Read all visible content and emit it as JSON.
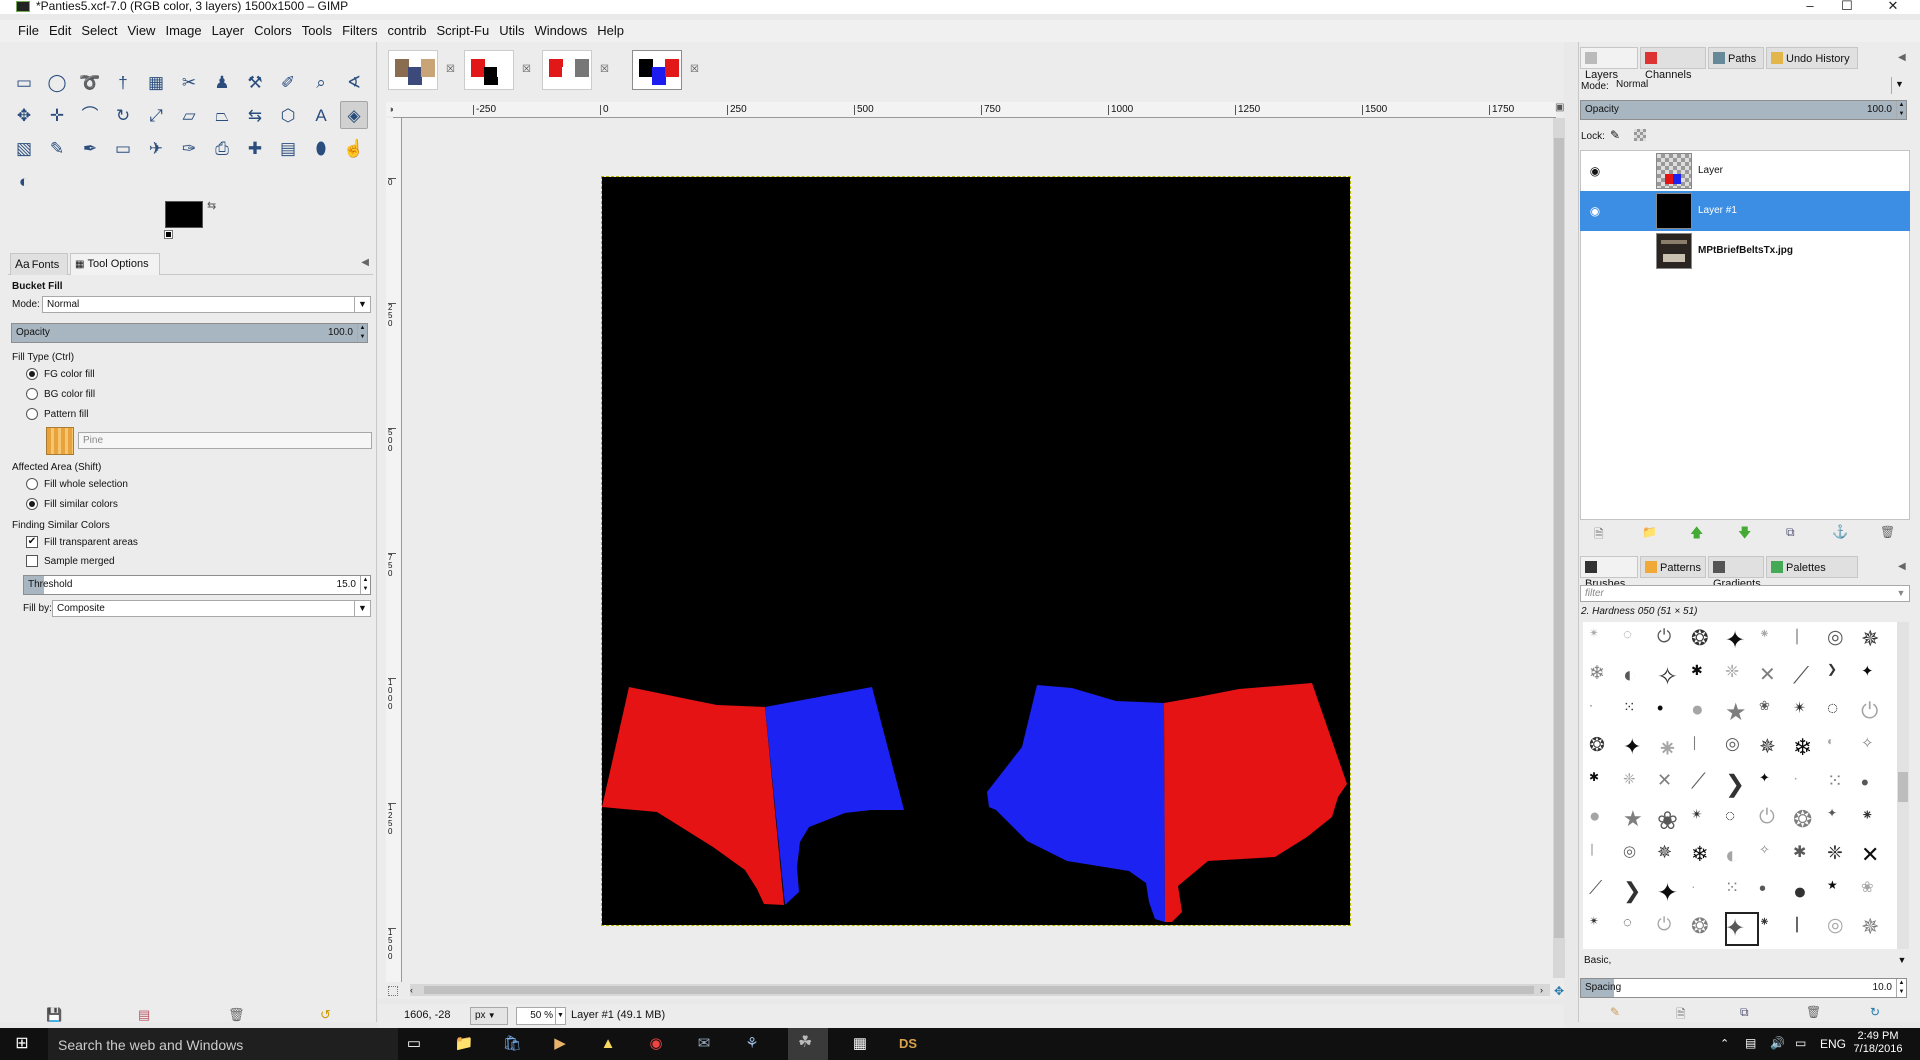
{
  "window": {
    "title": "*Panties5.xcf-7.0 (RGB color, 3 layers) 1500x1500 – GIMP",
    "minimize": "–",
    "maximize": "☐",
    "close": "✕"
  },
  "menu": [
    "File",
    "Edit",
    "Select",
    "View",
    "Image",
    "Layer",
    "Colors",
    "Tools",
    "Filters",
    "contrib",
    "Script-Fu",
    "Utils",
    "Windows",
    "Help"
  ],
  "toolbox": {
    "tools": [
      {
        "name": "rect-select-icon",
        "glyph": "▭"
      },
      {
        "name": "ellipse-select-icon",
        "glyph": "◯"
      },
      {
        "name": "free-select-icon",
        "glyph": "➰"
      },
      {
        "name": "fuzzy-select-icon",
        "glyph": "†"
      },
      {
        "name": "select-by-color-icon",
        "glyph": "▦"
      },
      {
        "name": "scissors-icon",
        "glyph": "✂"
      },
      {
        "name": "foreground-select-icon",
        "glyph": "♟"
      },
      {
        "name": "paths-icon",
        "glyph": "⚒"
      },
      {
        "name": "color-picker-icon",
        "glyph": "✐"
      },
      {
        "name": "zoom-icon",
        "glyph": "⌕"
      },
      {
        "name": "measure-icon",
        "glyph": "∢"
      },
      {
        "name": "move-icon",
        "glyph": "✥"
      },
      {
        "name": "align-icon",
        "glyph": "✛"
      },
      {
        "name": "crop-icon",
        "glyph": "⌒"
      },
      {
        "name": "rotate-icon",
        "glyph": "↻"
      },
      {
        "name": "scale-icon",
        "glyph": "⤢"
      },
      {
        "name": "shear-icon",
        "glyph": "▱"
      },
      {
        "name": "perspective-icon",
        "glyph": "⏢"
      },
      {
        "name": "flip-icon",
        "glyph": "⇆"
      },
      {
        "name": "cage-icon",
        "glyph": "⬡"
      },
      {
        "name": "text-icon",
        "glyph": "A"
      },
      {
        "name": "bucket-fill-icon",
        "glyph": "◈"
      },
      {
        "name": "blend-icon",
        "glyph": "▧"
      },
      {
        "name": "pencil-icon",
        "glyph": "✎"
      },
      {
        "name": "paintbrush-icon",
        "glyph": "✒"
      },
      {
        "name": "eraser-icon",
        "glyph": "▭"
      },
      {
        "name": "airbrush-icon",
        "glyph": "✈"
      },
      {
        "name": "ink-icon",
        "glyph": "✑"
      },
      {
        "name": "clone-icon",
        "glyph": "⎙"
      },
      {
        "name": "heal-icon",
        "glyph": "✚"
      },
      {
        "name": "perspective-clone-icon",
        "glyph": "▤"
      },
      {
        "name": "blur-icon",
        "glyph": "⬮"
      },
      {
        "name": "smudge-icon",
        "glyph": "☝"
      },
      {
        "name": "dodge-burn-icon",
        "glyph": "◐"
      }
    ],
    "fg_color": "#000000",
    "bg_color": "#ffffff"
  },
  "options": {
    "tab_fonts": "Fonts",
    "tab_fonts_icon": "Aa",
    "tab_tool_options": "Tool Options",
    "tool_name": "Bucket Fill",
    "mode_label": "Mode:",
    "mode_value": "Normal",
    "opacity_label": "Opacity",
    "opacity_value": "100.0",
    "opacity_percent": 100,
    "fill_type_label": "Fill Type  (Ctrl)",
    "fill_fg": "FG color fill",
    "fill_bg": "BG color fill",
    "fill_pattern": "Pattern fill",
    "pattern_name": "Pine",
    "affected_label": "Affected Area  (Shift)",
    "affected_whole": "Fill whole selection",
    "affected_similar": "Fill similar colors",
    "finding_label": "Finding Similar Colors",
    "fill_transparent": "Fill transparent areas",
    "fill_transparent_checked": true,
    "sample_merged": "Sample merged",
    "sample_merged_checked": false,
    "threshold_label": "Threshold",
    "threshold_value": "15.0",
    "threshold_fraction": 0.059,
    "fillby_label": "Fill by:",
    "fillby_value": "Composite"
  },
  "image_tabs": [
    {
      "name": "image-tab-1",
      "colors": [
        "#8a6d50",
        "#3b4a7a",
        "#c9a477"
      ]
    },
    {
      "name": "image-tab-2",
      "colors": [
        "#e21818",
        "#000000",
        "#ffffff"
      ]
    },
    {
      "name": "image-tab-3",
      "colors": [
        "#e21818",
        "#ffffff",
        "#777777"
      ]
    },
    {
      "name": "image-tab-4",
      "colors": [
        "#000000",
        "#1c1cf0",
        "#e21818"
      ]
    }
  ],
  "ruler": {
    "h_labels": [
      "-250",
      "0",
      "250",
      "500",
      "750",
      "1000",
      "1250",
      "1500",
      "1750"
    ],
    "v_labels": [
      "0",
      "250",
      "500",
      "750",
      "1000",
      "1250",
      "1500"
    ]
  },
  "canvas": {
    "bg": "#000000",
    "red": "#e51313",
    "blue": "#1c22f2"
  },
  "status": {
    "coords": "1606, -28",
    "unit": "px",
    "zoom": "50 %",
    "layer_info": "Layer #1 (49.1 MB)"
  },
  "layers_dock": {
    "tabs": [
      "Layers",
      "Channels",
      "Paths",
      "Undo History"
    ],
    "mode_label": "Mode:",
    "mode_value": "Normal",
    "opacity_label": "Opacity",
    "opacity_value": "100.0",
    "opacity_percent": 100,
    "lock_label": "Lock:",
    "layers": [
      {
        "name": "Layer",
        "visible": true,
        "selected": false
      },
      {
        "name": "Layer #1",
        "visible": true,
        "selected": true
      },
      {
        "name": "MPtBriefBeltsTx.jpg",
        "visible": false,
        "selected": false
      }
    ]
  },
  "brushes_dock": {
    "tabs": [
      "Brushes",
      "Patterns",
      "Gradients",
      "Palettes"
    ],
    "filter_placeholder": "filter",
    "brush_name": "2. Hardness 050 (51 × 51)",
    "preset_value": "Basic,",
    "spacing_label": "Spacing",
    "spacing_value": "10.0",
    "spacing_fraction": 0.1
  },
  "taskbar": {
    "search_placeholder": "Search the web and Windows",
    "lang": "ENG",
    "time": "2:49 PM",
    "date": "7/18/2016"
  }
}
